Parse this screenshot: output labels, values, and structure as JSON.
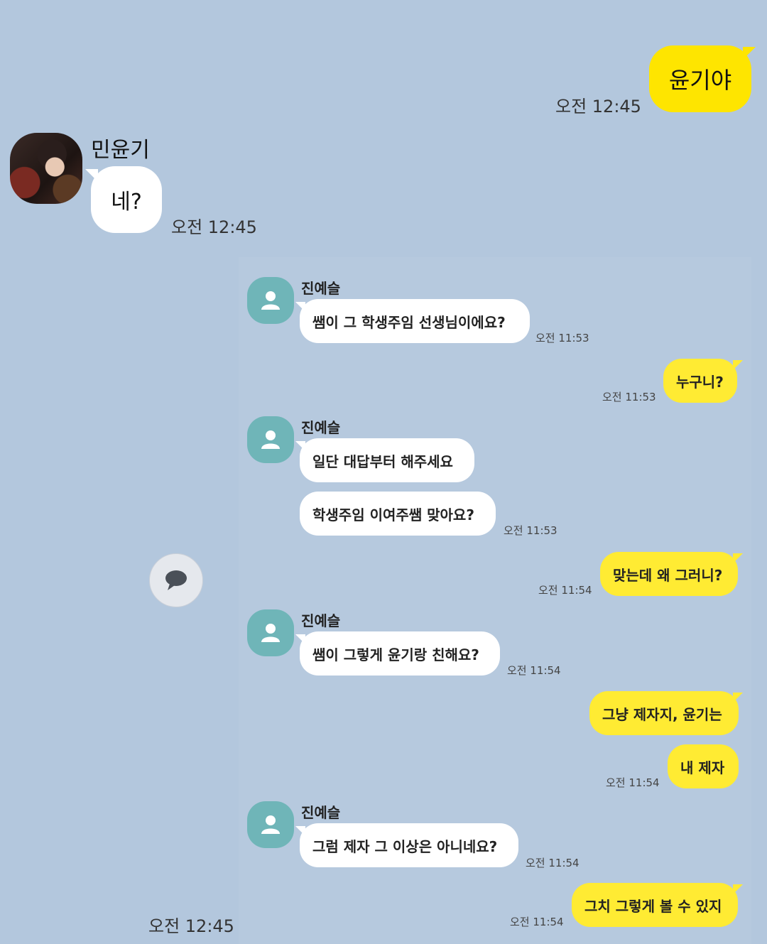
{
  "outer_chat": {
    "msg1": {
      "text": "윤기야",
      "time": "오전 12:45"
    },
    "msg2": {
      "sender": "민윤기",
      "text": "네?",
      "time": "오전 12:45"
    },
    "footer_time": "오전 12:45"
  },
  "embedded_chat": {
    "sender": "진예슬",
    "messages": [
      {
        "text": "쌤이 그 학생주임 선생님이에요?",
        "time": "오전 11:53"
      },
      {
        "text": "누구니?",
        "time": "오전 11:53"
      },
      {
        "text": "일단 대답부터 해주세요"
      },
      {
        "text": "학생주임 이여주쌤 맞아요?",
        "time": "오전 11:53"
      },
      {
        "text": "맞는데 왜 그러니?",
        "time": "오전 11:54"
      },
      {
        "text": "쌤이 그렇게 윤기랑 친해요?",
        "time": "오전 11:54"
      },
      {
        "text": "그냥 제자지, 윤기는"
      },
      {
        "text": "내 제자",
        "time": "오전 11:54"
      },
      {
        "text": "그럼 제자 그 이상은 아니네요?",
        "time": "오전 11:54"
      },
      {
        "text": "그치 그렇게 볼 수 있지",
        "time": "오전 11:54"
      }
    ]
  },
  "icons": {
    "comment": "speech-bubble-icon",
    "profile": "default-profile-icon"
  },
  "colors": {
    "background": "#b3c7dd",
    "my_bubble": "#fee500",
    "their_bubble": "#ffffff",
    "profile_default": "#6fb5b8"
  }
}
